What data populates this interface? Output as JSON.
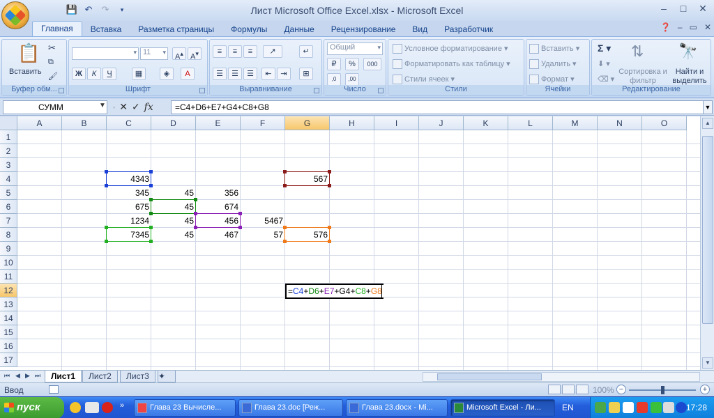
{
  "window": {
    "title": "Лист Microsoft Office Excel.xlsx - Microsoft Excel",
    "controls": [
      "–",
      "□",
      "✕"
    ]
  },
  "ribbon_tabs": [
    "Главная",
    "Вставка",
    "Разметка страницы",
    "Формулы",
    "Данные",
    "Рецензирование",
    "Вид",
    "Разработчик"
  ],
  "ribbon": {
    "clipboard": {
      "label": "Буфер обм...",
      "paste": "Вставить"
    },
    "font": {
      "label": "Шрифт",
      "size": "11",
      "bold": "Ж",
      "italic": "К",
      "underline": "Ч"
    },
    "alignment": {
      "label": "Выравнивание"
    },
    "number": {
      "label": "Число",
      "format": "Общий",
      "percent": "%",
      "thousands": "000"
    },
    "styles": {
      "label": "Стили",
      "conditional": "Условное форматирование",
      "as_table": "Форматировать как таблицу",
      "cell_styles": "Стили ячеек"
    },
    "cells": {
      "label": "Ячейки",
      "insert": "Вставить",
      "delete": "Удалить",
      "format": "Формат"
    },
    "editing": {
      "label": "Редактирование",
      "sort": "Сортировка и фильтр",
      "find": "Найти и выделить"
    }
  },
  "formula_bar": {
    "name_box": "СУММ",
    "cancel": "✕",
    "enter": "✓",
    "fx": "fx",
    "formula": "=C4+D6+E7+G4+C8+G8"
  },
  "columns": [
    "A",
    "B",
    "C",
    "D",
    "E",
    "F",
    "G",
    "H",
    "I",
    "J",
    "K",
    "L",
    "M",
    "N",
    "O"
  ],
  "rows": [
    "1",
    "2",
    "3",
    "4",
    "5",
    "6",
    "7",
    "8",
    "9",
    "10",
    "11",
    "12",
    "13",
    "14",
    "15",
    "16",
    "17"
  ],
  "cells": {
    "C4": "4343",
    "G4": "567",
    "C5": "345",
    "D5": "45",
    "E5": "356",
    "C6": "675",
    "D6": "45",
    "E6": "674",
    "C7": "1234",
    "D7": "45",
    "E7": "456",
    "F7": "5467",
    "C8": "7345",
    "D8": "45",
    "E8": "467",
    "F8": "57",
    "G8": "576"
  },
  "edit_formula": [
    {
      "text": "=",
      "color": "#000000"
    },
    {
      "text": "C4",
      "color": "#1a3fd6"
    },
    {
      "text": "+",
      "color": "#000000"
    },
    {
      "text": "D6",
      "color": "#138a13"
    },
    {
      "text": "+",
      "color": "#000000"
    },
    {
      "text": "E7",
      "color": "#8a1fb5"
    },
    {
      "text": "+G4+",
      "color": "#000000"
    },
    {
      "text": "C8",
      "color": "#22b022"
    },
    {
      "text": "+",
      "color": "#000000"
    },
    {
      "text": "G8",
      "color": "#f07a1a"
    }
  ],
  "ref_colors": {
    "C4": "#1a3fd6",
    "D6": "#138a13",
    "E7": "#8a1fb5",
    "G4": "#8b1a1a",
    "C8": "#22b022",
    "G8": "#f07a1a"
  },
  "sheets": [
    "Лист1",
    "Лист2",
    "Лист3"
  ],
  "status": {
    "mode": "Ввод",
    "zoom": "100%"
  },
  "taskbar": {
    "start": "пуск",
    "tasks": [
      "Глава 23 Вычисле...",
      "Глава 23.doc [Реж...",
      "Глава 23.docx - Mi...",
      "Microsoft Excel - Ли..."
    ],
    "lang": "EN",
    "clock": "17:28"
  }
}
